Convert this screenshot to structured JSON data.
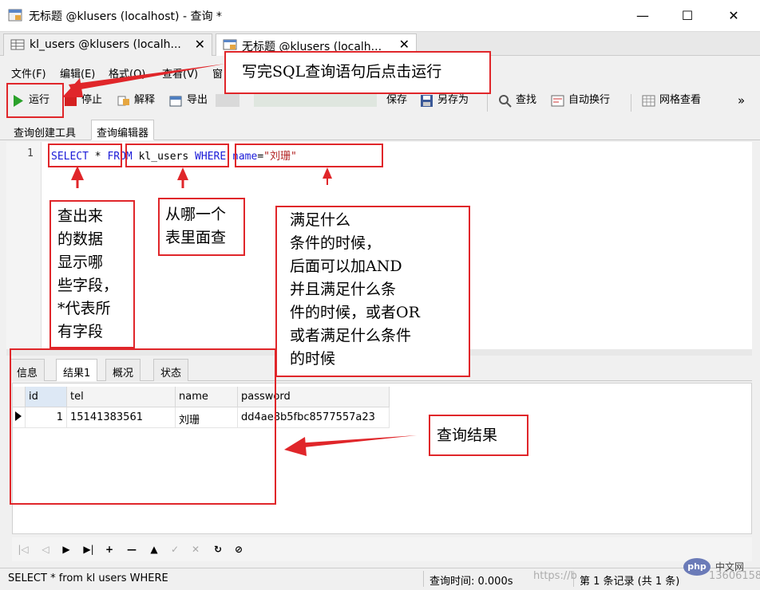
{
  "window": {
    "title": "无标题 @klusers (localhost) - 查询 *",
    "minimize": "—",
    "maximize": "☐",
    "close": "✕"
  },
  "doc_tabs": [
    {
      "label": "kl_users @klusers (localh...",
      "close": "✕"
    },
    {
      "label": "无标题 @klusers (localh...",
      "close": "✕"
    }
  ],
  "menu": [
    "文件(F)",
    "编辑(E)",
    "格式(O)",
    "查看(V)",
    "窗"
  ],
  "toolbar": {
    "run": "运行",
    "stop": "停止",
    "explain": "解释",
    "export": "导出",
    "save": "保存",
    "save_as": "另存为",
    "find": "查找",
    "word_wrap": "自动换行",
    "grid_view": "网格查看",
    "more": "»"
  },
  "sub_tabs": [
    "查询创建工具",
    "查询编辑器"
  ],
  "editor": {
    "line_number": "1",
    "sql": {
      "select": "SELECT",
      "star": " * ",
      "from": "FROM",
      "table": " kl_users ",
      "where": "WHERE",
      "field": " name",
      "eq": "=",
      "value": "\"刘珊\""
    }
  },
  "result_tabs": [
    "信息",
    "结果1",
    "概况",
    "状态"
  ],
  "result_grid": {
    "columns": [
      "id",
      "tel",
      "name",
      "password"
    ],
    "rows": [
      {
        "id": "1",
        "tel": "15141383561",
        "name": "刘珊",
        "password": "dd4ae8b5fbc8577557a23"
      }
    ]
  },
  "nav_buttons": [
    "|◁",
    "◁",
    "▶",
    "▶|",
    "+",
    "—",
    "▲",
    "✓",
    "✕",
    "↻",
    "⊘"
  ],
  "status": {
    "query_text": "SELECT * from kl users WHERE",
    "query_time": "查询时间: 0.000s",
    "records": "第 1 条记录 (共 1 条)",
    "watermark_left": "https://b",
    "watermark_right": "13606158",
    "php_logo": "php",
    "php_cn": "中文网"
  },
  "annotations": {
    "run_hint": "写完SQL查询语句后点击运行",
    "select_fields": [
      "查出来",
      "的数据",
      "显示哪",
      "些字段，",
      "*代表所",
      "有字段"
    ],
    "from_table": [
      "从哪一个",
      "表里面查"
    ],
    "where_cond": [
      "满足什么",
      "条件的时候，",
      "后面可以加AND",
      "并且满足什么条",
      "件的时候，或者OR",
      "或者满足什么条件",
      "的时候"
    ],
    "result": "查询结果"
  },
  "colors": {
    "annotation_red": "#e0262a",
    "keyword_blue": "#1b1bd8",
    "string_red": "#b22222"
  }
}
